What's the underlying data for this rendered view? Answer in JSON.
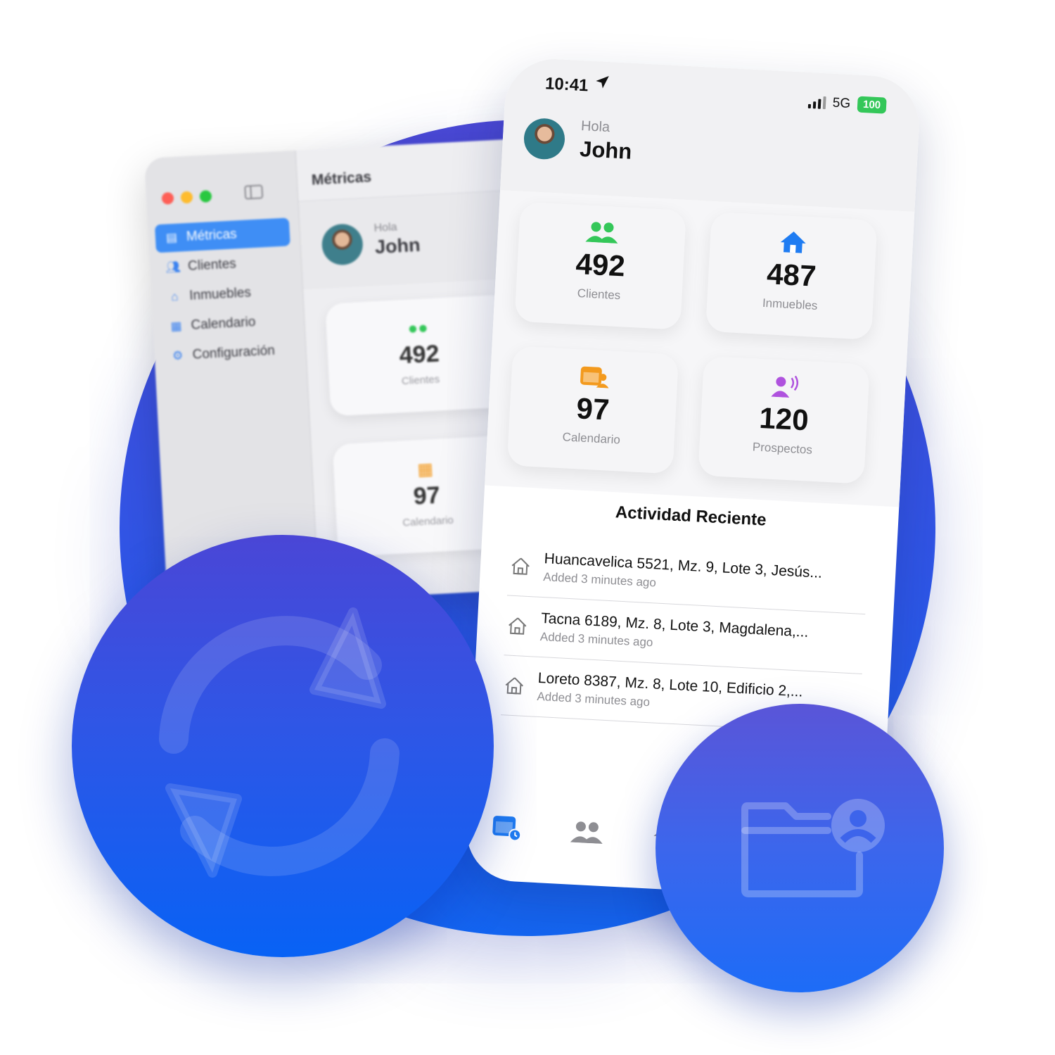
{
  "mac": {
    "title": "Métricas",
    "sidebar": [
      {
        "label": "Métricas",
        "icon": "metrics-icon",
        "active": true
      },
      {
        "label": "Clientes",
        "icon": "people-icon"
      },
      {
        "label": "Inmuebles",
        "icon": "house-icon"
      },
      {
        "label": "Calendario",
        "icon": "calendar-icon"
      },
      {
        "label": "Configuración",
        "icon": "gear-icon"
      }
    ],
    "greeting": "Hola",
    "user_name": "John",
    "cards": [
      {
        "value": "492",
        "label": "Clientes"
      },
      {
        "value": "97",
        "label": "Calendario"
      }
    ]
  },
  "phone": {
    "status": {
      "time": "10:41",
      "network": "5G",
      "battery": "100"
    },
    "greeting": "Hola",
    "user_name": "John",
    "metrics": [
      {
        "value": "492",
        "label": "Clientes",
        "icon": "people-icon",
        "color": "#34c759"
      },
      {
        "value": "487",
        "label": "Inmuebles",
        "icon": "house-icon",
        "color": "#1f7cf2"
      },
      {
        "value": "97",
        "label": "Calendario",
        "icon": "calendar-person-icon",
        "color": "#f39a1e"
      },
      {
        "value": "120",
        "label": "Prospectos",
        "icon": "person-wave-icon",
        "color": "#af52de"
      }
    ],
    "section_title": "Actividad Reciente",
    "activity": [
      {
        "title": "Huancavelica 5521, Mz. 9, Lote 3, Jesús...",
        "subtitle": "Added 3 minutes ago"
      },
      {
        "title": "Tacna 6189, Mz. 8, Lote 3, Magdalena,...",
        "subtitle": "Added 3 minutes ago"
      },
      {
        "title": "Loreto 8387, Mz. 8, Lote 10, Edificio 2,...",
        "subtitle": "Added 3 minutes ago"
      }
    ],
    "tabs": [
      "calendar-tab-icon",
      "people-tab-icon",
      "house-tab-icon"
    ]
  },
  "badges": {
    "sync": "sync-icon",
    "folder": "folder-person-icon"
  },
  "colors": {
    "accent": "#1f7cf2",
    "blob": "#2f55e6"
  }
}
